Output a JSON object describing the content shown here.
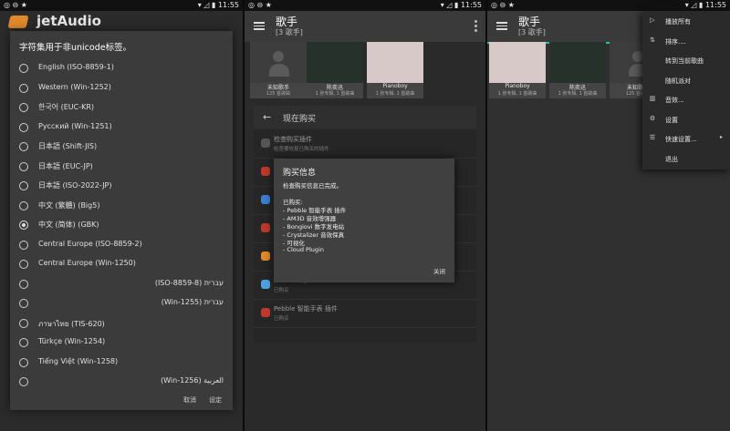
{
  "status_bar": {
    "left_icons": "◎ ⊖ ★",
    "right_icons": "▾ ◿ ▮",
    "time": "11:55"
  },
  "panel1": {
    "app_title": "jetAudio",
    "dialog": {
      "title": "字符集用于非unicode标签。",
      "options": [
        {
          "label": "English (ISO-8859-1)",
          "selected": false,
          "rtl": false
        },
        {
          "label": "Western (Win-1252)",
          "selected": false,
          "rtl": false
        },
        {
          "label": "한국어 (EUC-KR)",
          "selected": false,
          "rtl": false
        },
        {
          "label": "Русский (Win-1251)",
          "selected": false,
          "rtl": false
        },
        {
          "label": "日本語 (Shift-JIS)",
          "selected": false,
          "rtl": false
        },
        {
          "label": "日本語 (EUC-JP)",
          "selected": false,
          "rtl": false
        },
        {
          "label": "日本語 (ISO-2022-JP)",
          "selected": false,
          "rtl": false
        },
        {
          "label": "中文 (繁體) (Big5)",
          "selected": false,
          "rtl": false
        },
        {
          "label": "中文 (简体) (GBK)",
          "selected": true,
          "rtl": false
        },
        {
          "label": "Central Europe (ISO-8859-2)",
          "selected": false,
          "rtl": false
        },
        {
          "label": "Central Europe (Win-1250)",
          "selected": false,
          "rtl": false
        },
        {
          "label": "(ISO-8859-8) עברית",
          "selected": false,
          "rtl": true
        },
        {
          "label": "(Win-1255) עברית",
          "selected": false,
          "rtl": true
        },
        {
          "label": "ภาษาไทย (TIS-620)",
          "selected": false,
          "rtl": false
        },
        {
          "label": "Türkçe (Win-1254)",
          "selected": false,
          "rtl": false
        },
        {
          "label": "Tiếng Việt (Win-1258)",
          "selected": false,
          "rtl": false
        },
        {
          "label": "(Win-1256) العربية",
          "selected": false,
          "rtl": true
        }
      ],
      "cancel_label": "取消",
      "ok_label": "设定"
    }
  },
  "panel2": {
    "title": "歌手",
    "subtitle": "[3 歌手]",
    "artists": [
      {
        "name": "未知歌手",
        "meta": "125 首歌曲",
        "color": "#3d3d3d"
      },
      {
        "name": "陈奕迅",
        "meta": "1 张专辑, 1 首歌曲",
        "color": "#27312c"
      },
      {
        "name": "Pianoboy",
        "meta": "1 张专辑, 1 首歌曲",
        "color": "#d8c9c9"
      }
    ],
    "purchase_panel": {
      "back_icon": "←",
      "title": "现在购买",
      "items": [
        {
          "title": "检查购买插件",
          "subtitle": "检查要恢复已购买的插件",
          "color": "#555555"
        },
        {
          "title": "Pebble 智能手表 插件",
          "subtitle": "已购买",
          "color": "#c0392b"
        },
        {
          "title": "AM3D 音效增强器",
          "subtitle": "已购买",
          "color": "#3a7fd0"
        },
        {
          "title": "Bongiovi 数字发电站",
          "subtitle": "已购买",
          "color": "#c0392b"
        },
        {
          "title": "Crystalizer 音效保真",
          "subtitle": "已购买",
          "color": "#e08a2c"
        },
        {
          "title": "Cloud Plugin",
          "subtitle": "已购买",
          "color": "#4aa3df"
        },
        {
          "title": "Pebble 智能手表 插件",
          "subtitle": "已购买",
          "color": "#c0392b"
        }
      ]
    },
    "info_dialog": {
      "title": "购买信息",
      "message": "检查购买信息已完成。",
      "purchased_header": "已购买:",
      "items": [
        "- Pebble 智能手表 插件",
        "- AM3D 音效增强器",
        "- Bongiovi 数字发电站",
        "- Crystalizer 音效保真",
        "- 可视化",
        "- Cloud Plugin"
      ],
      "close_label": "关闭"
    }
  },
  "panel3": {
    "title": "歌手",
    "subtitle": "[3 歌手]",
    "accent_color": "#2bbfa8",
    "artists": [
      {
        "name": "Pianoboy",
        "meta": "1 张专辑, 1 首歌曲",
        "color": "#d8c9c9"
      },
      {
        "name": "陈奕迅",
        "meta": "1 张专辑, 1 首歌曲",
        "color": "#27312c"
      },
      {
        "name": "未知歌手",
        "meta": "125 首歌曲",
        "color": "#3d3d3d"
      }
    ],
    "menu": [
      {
        "icon": "▷",
        "label": "播放所有",
        "submenu": false
      },
      {
        "icon": "⇅",
        "label": "排序....",
        "submenu": false
      },
      {
        "icon": "",
        "label": "转到当前歌曲",
        "submenu": false
      },
      {
        "icon": "",
        "label": "随机派对",
        "submenu": false
      },
      {
        "icon": "▥",
        "label": "音效...",
        "submenu": false
      },
      {
        "icon": "⚙",
        "label": "设置",
        "submenu": false
      },
      {
        "icon": "☰",
        "label": "快速设置...",
        "submenu": true
      },
      {
        "icon": "",
        "label": "退出",
        "submenu": false
      }
    ]
  }
}
